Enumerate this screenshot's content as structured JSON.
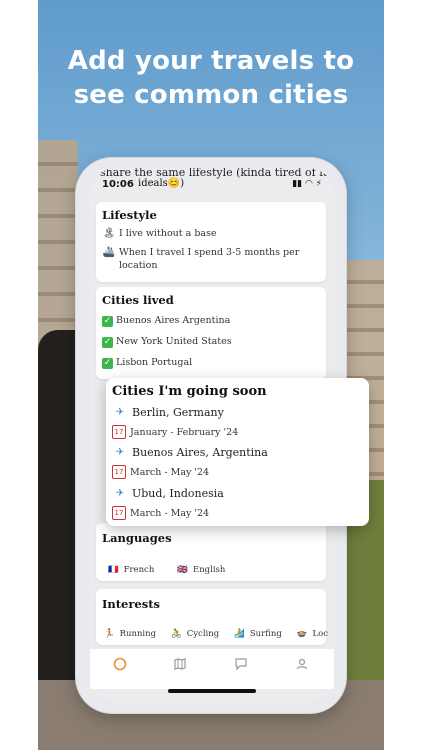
{
  "headline": "Add your travels to see common cities",
  "status": {
    "time": "10:06",
    "icons": "▮▮ ◠ ⚡"
  },
  "cut_text": "share the same lifestyle (kinda tired of failing",
  "cut_text2": "ideals😊)",
  "lifestyle": {
    "title": "Lifestyle",
    "items": [
      {
        "emoji": "🏝",
        "text": "I live without a base"
      },
      {
        "emoji": "🚢",
        "text": "When I travel I spend 3-5 months per location"
      }
    ]
  },
  "cities_lived": {
    "title": "Cities lived",
    "items": [
      "Buenos Aires Argentina",
      "New York United States",
      "Lisbon Portugal"
    ]
  },
  "going_soon": {
    "title": "Cities I'm going soon",
    "trips": [
      {
        "city": "Berlin, Germany",
        "dates": "January - February '24"
      },
      {
        "city": "Buenos Aires, Argentina",
        "dates": "March - May '24"
      },
      {
        "city": "Ubud, Indonesia",
        "dates": "March - May '24"
      }
    ]
  },
  "languages": {
    "title": "Languages",
    "items": [
      {
        "flag": "🇫🇷",
        "label": "French"
      },
      {
        "flag": "🇬🇧",
        "label": "English"
      }
    ]
  },
  "interests": {
    "title": "Interests",
    "items": [
      {
        "icon": "🏃",
        "label": "Running"
      },
      {
        "icon": "🚴",
        "label": "Cycling"
      },
      {
        "icon": "🏄",
        "label": "Surfing"
      },
      {
        "icon": "🍲",
        "label": "Local S"
      }
    ]
  },
  "tabs": [
    "home-icon",
    "map-icon",
    "chat-icon",
    "profile-icon"
  ],
  "colors": {
    "accent": "#f0913a",
    "check": "#3cb54a",
    "plane": "#4a7fd0"
  }
}
